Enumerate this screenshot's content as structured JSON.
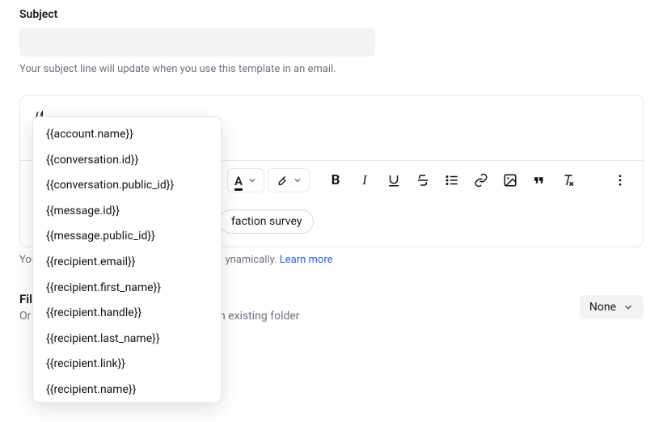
{
  "subject": {
    "label": "Subject",
    "value": "",
    "helper": "Your subject line will update when you use this template in an email."
  },
  "editor": {
    "typed": "{{"
  },
  "autocomplete": {
    "items": [
      "{{account.name}}",
      "{{conversation.id}}",
      "{{conversation.public_id}}",
      "{{message.id}}",
      "{{message.public_id}}",
      "{{recipient.email}}",
      "{{recipient.first_name}}",
      "{{recipient.handle}}",
      "{{recipient.last_name}}",
      "{{recipient.link}}",
      "{{recipient.name}}"
    ]
  },
  "chips": {
    "visible": "faction survey"
  },
  "dynamic_hint": {
    "prefix": "You",
    "middle": "ynamically. ",
    "link": "Learn more"
  },
  "files": {
    "heading_visible": "Fil",
    "sub_prefix": "Or",
    "sub_visible": "an existing folder",
    "select_label": "None"
  },
  "toolbar": {
    "text_color_letter": "A",
    "bold": "B",
    "italic": "I"
  }
}
